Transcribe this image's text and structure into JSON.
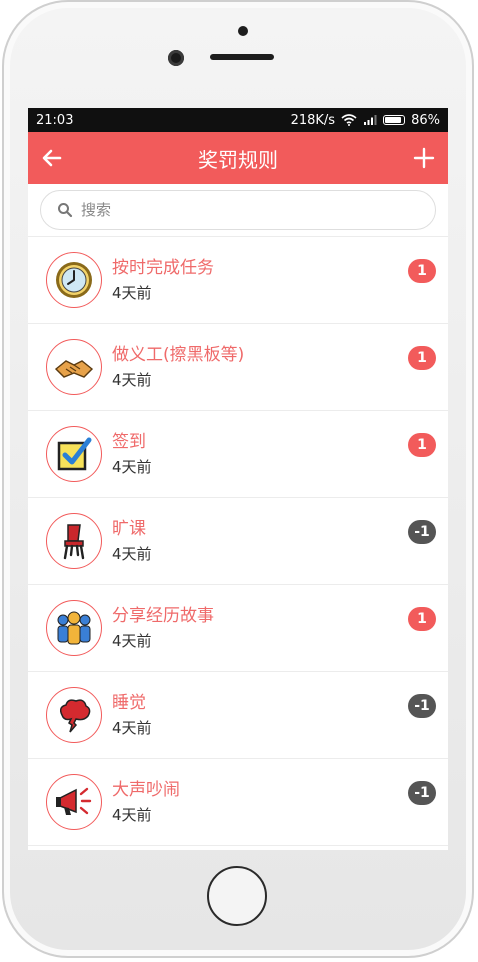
{
  "status": {
    "time": "21:03",
    "speed": "218K/s",
    "battery": "86%"
  },
  "header": {
    "title": "奖罚规则",
    "back_icon": "arrow-left-icon",
    "add_icon": "plus-icon"
  },
  "search": {
    "placeholder": "搜索",
    "value": ""
  },
  "items": [
    {
      "name": "按时完成任务",
      "time": "4天前",
      "score": "1",
      "icon": "clock-icon",
      "type": "positive"
    },
    {
      "name": "做义工(擦黑板等)",
      "time": "4天前",
      "score": "1",
      "icon": "handshake-icon",
      "type": "positive"
    },
    {
      "name": "签到",
      "time": "4天前",
      "score": "1",
      "icon": "checkbox-icon",
      "type": "positive"
    },
    {
      "name": "旷课",
      "time": "4天前",
      "score": "-1",
      "icon": "empty-chair-icon",
      "type": "negative"
    },
    {
      "name": "分享经历故事",
      "time": "4天前",
      "score": "1",
      "icon": "group-people-icon",
      "type": "positive"
    },
    {
      "name": "睡觉",
      "time": "4天前",
      "score": "-1",
      "icon": "sleep-cloud-icon",
      "type": "negative"
    },
    {
      "name": "大声吵闹",
      "time": "4天前",
      "score": "-1",
      "icon": "megaphone-icon",
      "type": "negative"
    }
  ],
  "colors": {
    "accent": "#f25b5b",
    "negative_badge": "#555555",
    "item_name": "#ef6a6a"
  }
}
